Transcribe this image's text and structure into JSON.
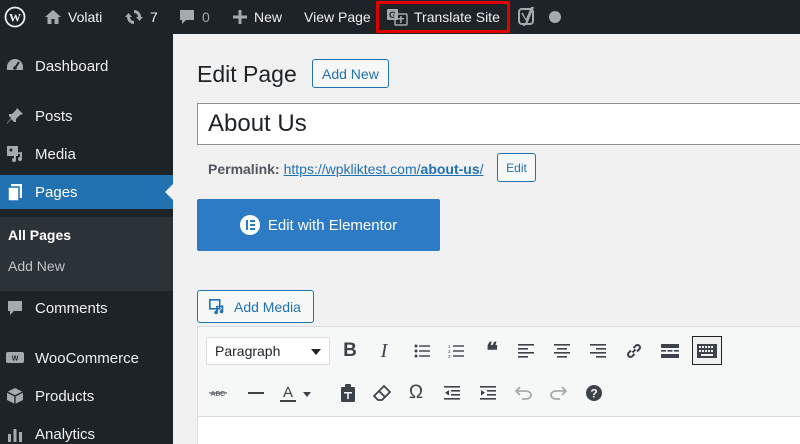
{
  "adminbar": {
    "site_name": "Volati",
    "updates_count": "7",
    "comments_count": "0",
    "new_label": "New",
    "view_page_label": "View Page",
    "translate_label": "Translate Site"
  },
  "sidebar": {
    "items": {
      "dashboard": "Dashboard",
      "posts": "Posts",
      "media": "Media",
      "pages": "Pages",
      "comments": "Comments",
      "woocommerce": "WooCommerce",
      "products": "Products",
      "analytics": "Analytics"
    },
    "submenu": {
      "all_pages": "All Pages",
      "add_new": "Add New"
    }
  },
  "main": {
    "title": "Edit Page",
    "add_new": "Add New",
    "page_title_value": "About Us",
    "permalink_label": "Permalink:",
    "permalink_base": "https://wpkliktest.com/",
    "permalink_slug": "about-us",
    "permalink_end": "/",
    "permalink_edit": "Edit",
    "elementor_button": "Edit with Elementor",
    "add_media": "Add Media"
  },
  "editor": {
    "format_value": "Paragraph",
    "bold_glyph": "B",
    "italic_glyph": "I",
    "omega_glyph": "Ω",
    "quote_glyph": "❝"
  },
  "colors": {
    "admin_bg": "#1d2327",
    "accent": "#2271b1",
    "elementor": "#2d7bc4",
    "highlight_border": "#e00000"
  }
}
